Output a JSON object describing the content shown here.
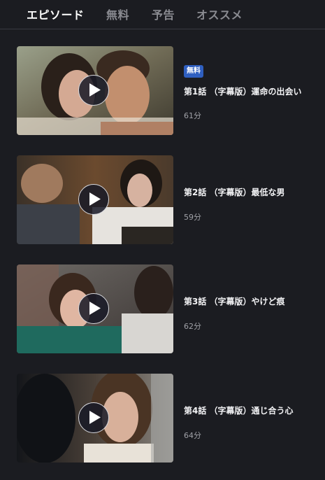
{
  "tabs": [
    {
      "label": "エピソード",
      "active": true
    },
    {
      "label": "無料",
      "active": false
    },
    {
      "label": "予告",
      "active": false
    },
    {
      "label": "オススメ",
      "active": false
    }
  ],
  "episodes": [
    {
      "title": "第1話 （字幕版）運命の出会い",
      "duration": "61分",
      "badge": "無料"
    },
    {
      "title": "第2話 （字幕版）最低な男",
      "duration": "59分"
    },
    {
      "title": "第3話 （字幕版）やけど痕",
      "duration": "62分"
    },
    {
      "title": "第4話 （字幕版）通じ合う心",
      "duration": "64分"
    }
  ],
  "colors": {
    "background": "#1b1c21",
    "active_tab": "#ffffff",
    "inactive_tab": "#8a8b91",
    "badge": "#2f5fc0",
    "duration": "#a0a1a7"
  },
  "icons": {
    "play": "play-icon"
  }
}
